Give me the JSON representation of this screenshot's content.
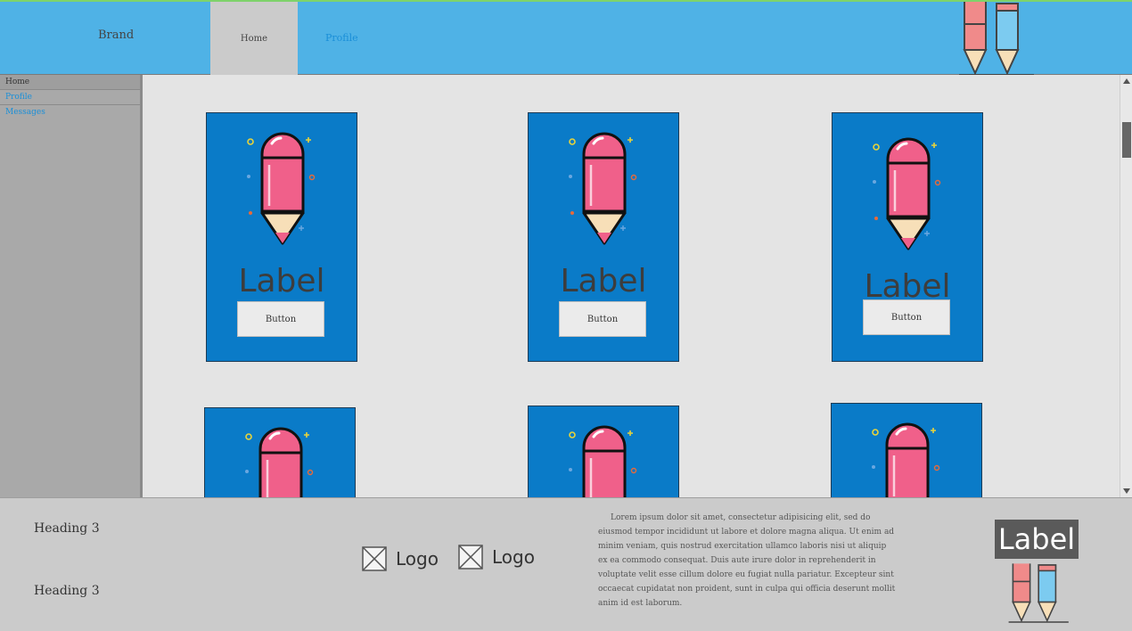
{
  "header": {
    "brand": "Brand",
    "nav": {
      "home": "Home",
      "profile": "Profile"
    }
  },
  "sidebar": {
    "items": [
      {
        "label": "Home"
      },
      {
        "label": "Profile"
      },
      {
        "label": "Messages"
      }
    ]
  },
  "cards": [
    {
      "label": "Label",
      "button": "Button"
    },
    {
      "label": "Label",
      "button": "Button"
    },
    {
      "label": "Label",
      "button": "Button"
    }
  ],
  "footer": {
    "heading_1": "Heading 3",
    "heading_2": "Heading 3",
    "logo_1": "Logo",
    "logo_2": "Logo",
    "paragraph": "Lorem ipsum dolor sit amet, consectetur adipisicing elit, sed do eiusmod tempor incididunt ut labore et dolore magna aliqua. Ut enim ad minim veniam, quis nostrud exercitation ullamco laboris nisi ut aliquip ex ea commodo consequat. Duis aute irure dolor in reprehenderit in voluptate velit esse cillum dolore eu fugiat nulla pariatur. Excepteur sint occaecat cupidatat non proident, sunt in culpa qui officia deserunt mollit anim id est laborum.",
    "label": "Label"
  },
  "colors": {
    "topbar": "#4fb2e6",
    "card": "#0a7bc8",
    "pencil": "#f0608a",
    "link": "#1a8fd8"
  },
  "icons": [
    "pencil-illustration-icon",
    "pencils-icon",
    "image-placeholder-icon",
    "scroll-up-icon",
    "scroll-down-icon"
  ]
}
